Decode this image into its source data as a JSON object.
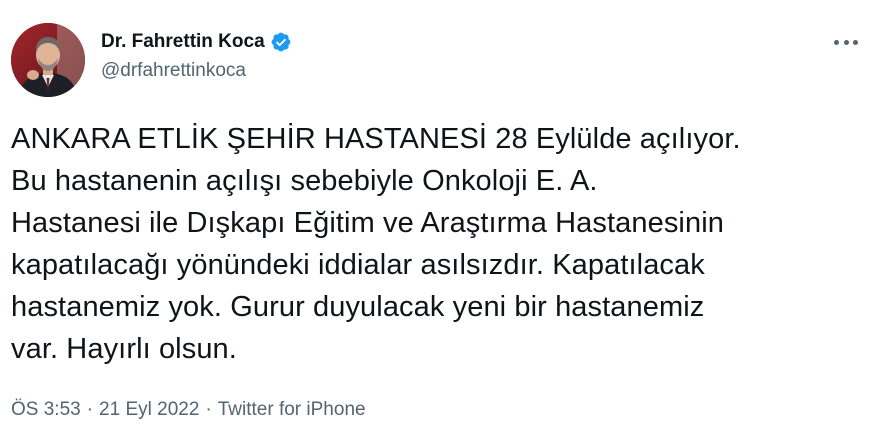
{
  "user": {
    "display_name": "Dr. Fahrettin Koca",
    "handle": "@drfahrettinkoca",
    "verified": true,
    "verified_color": "#1d9bf0"
  },
  "menu": {
    "icon": "more-horizontal-icon"
  },
  "tweet": {
    "text": "ANKARA ETLİK ŞEHİR HASTANESİ 28 Eylülde açılıyor.\nBu hastanenin açılışı sebebiyle Onkoloji E. A.\nHastanesi ile Dışkapı Eğitim ve Araştırma Hastanesinin\nkapatılacağı yönündeki iddialar asılsızdır. Kapatılacak\nhastanemiz yok. Gurur duyulacak yeni bir hastanemiz\nvar. Hayırlı olsun."
  },
  "meta": {
    "time": "ÖS 3:53",
    "separator": "·",
    "date": "21 Eyl 2022",
    "source": "Twitter for iPhone"
  },
  "colors": {
    "text_primary": "#0f1419",
    "text_secondary": "#536471",
    "background": "#ffffff"
  }
}
